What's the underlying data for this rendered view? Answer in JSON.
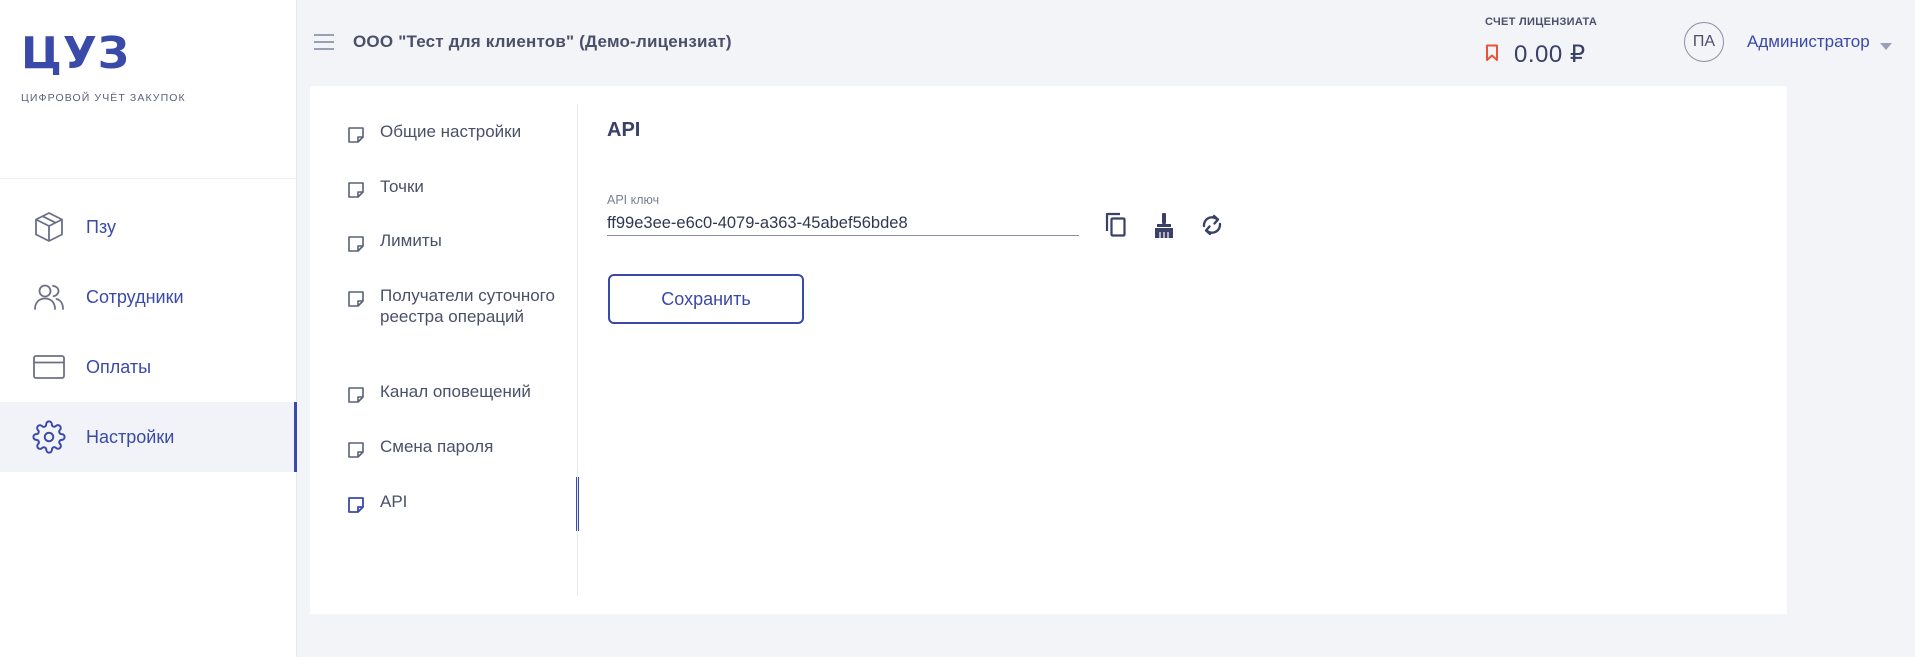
{
  "brand": {
    "logo": "ЦУЗ",
    "tagline": "ЦИФРОВОЙ УЧЁТ ЗАКУПОК"
  },
  "sidebar": {
    "items": [
      {
        "label": "Пзу",
        "icon": "box-icon",
        "active": false
      },
      {
        "label": "Сотрудники",
        "icon": "users-icon",
        "active": false
      },
      {
        "label": "Оплаты",
        "icon": "credit-card-icon",
        "active": false
      },
      {
        "label": "Настройки",
        "icon": "gear-icon",
        "active": true
      }
    ]
  },
  "header": {
    "org_name": "ООО \"Тест для клиентов\" (Демо-лицензиат)",
    "account_caption": "СЧЕТ ЛИЦЕНЗИАТА",
    "account_value": "0.00 ₽",
    "avatar_initials": "ПА",
    "user_name": "Администратор"
  },
  "settings_menu": {
    "items": [
      {
        "label": "Общие настройки"
      },
      {
        "label": "Точки"
      },
      {
        "label": "Лимиты"
      },
      {
        "label": "Получатели суточного реестра операций"
      },
      {
        "label": "Канал оповещений"
      },
      {
        "label": "Смена пароля"
      },
      {
        "label": "API"
      }
    ],
    "active_item": "API"
  },
  "api_section": {
    "title": "API",
    "key_label": "API ключ",
    "key_value": "ff99e3ee-e6c0-4079-a363-45abef56bde8",
    "actions": [
      "copy-icon",
      "broom-icon",
      "refresh-icon"
    ],
    "save_label": "Сохранить"
  },
  "colors": {
    "accent": "#3a4aa8",
    "background": "#f3f4f8",
    "bookmark": "#e8543a"
  }
}
